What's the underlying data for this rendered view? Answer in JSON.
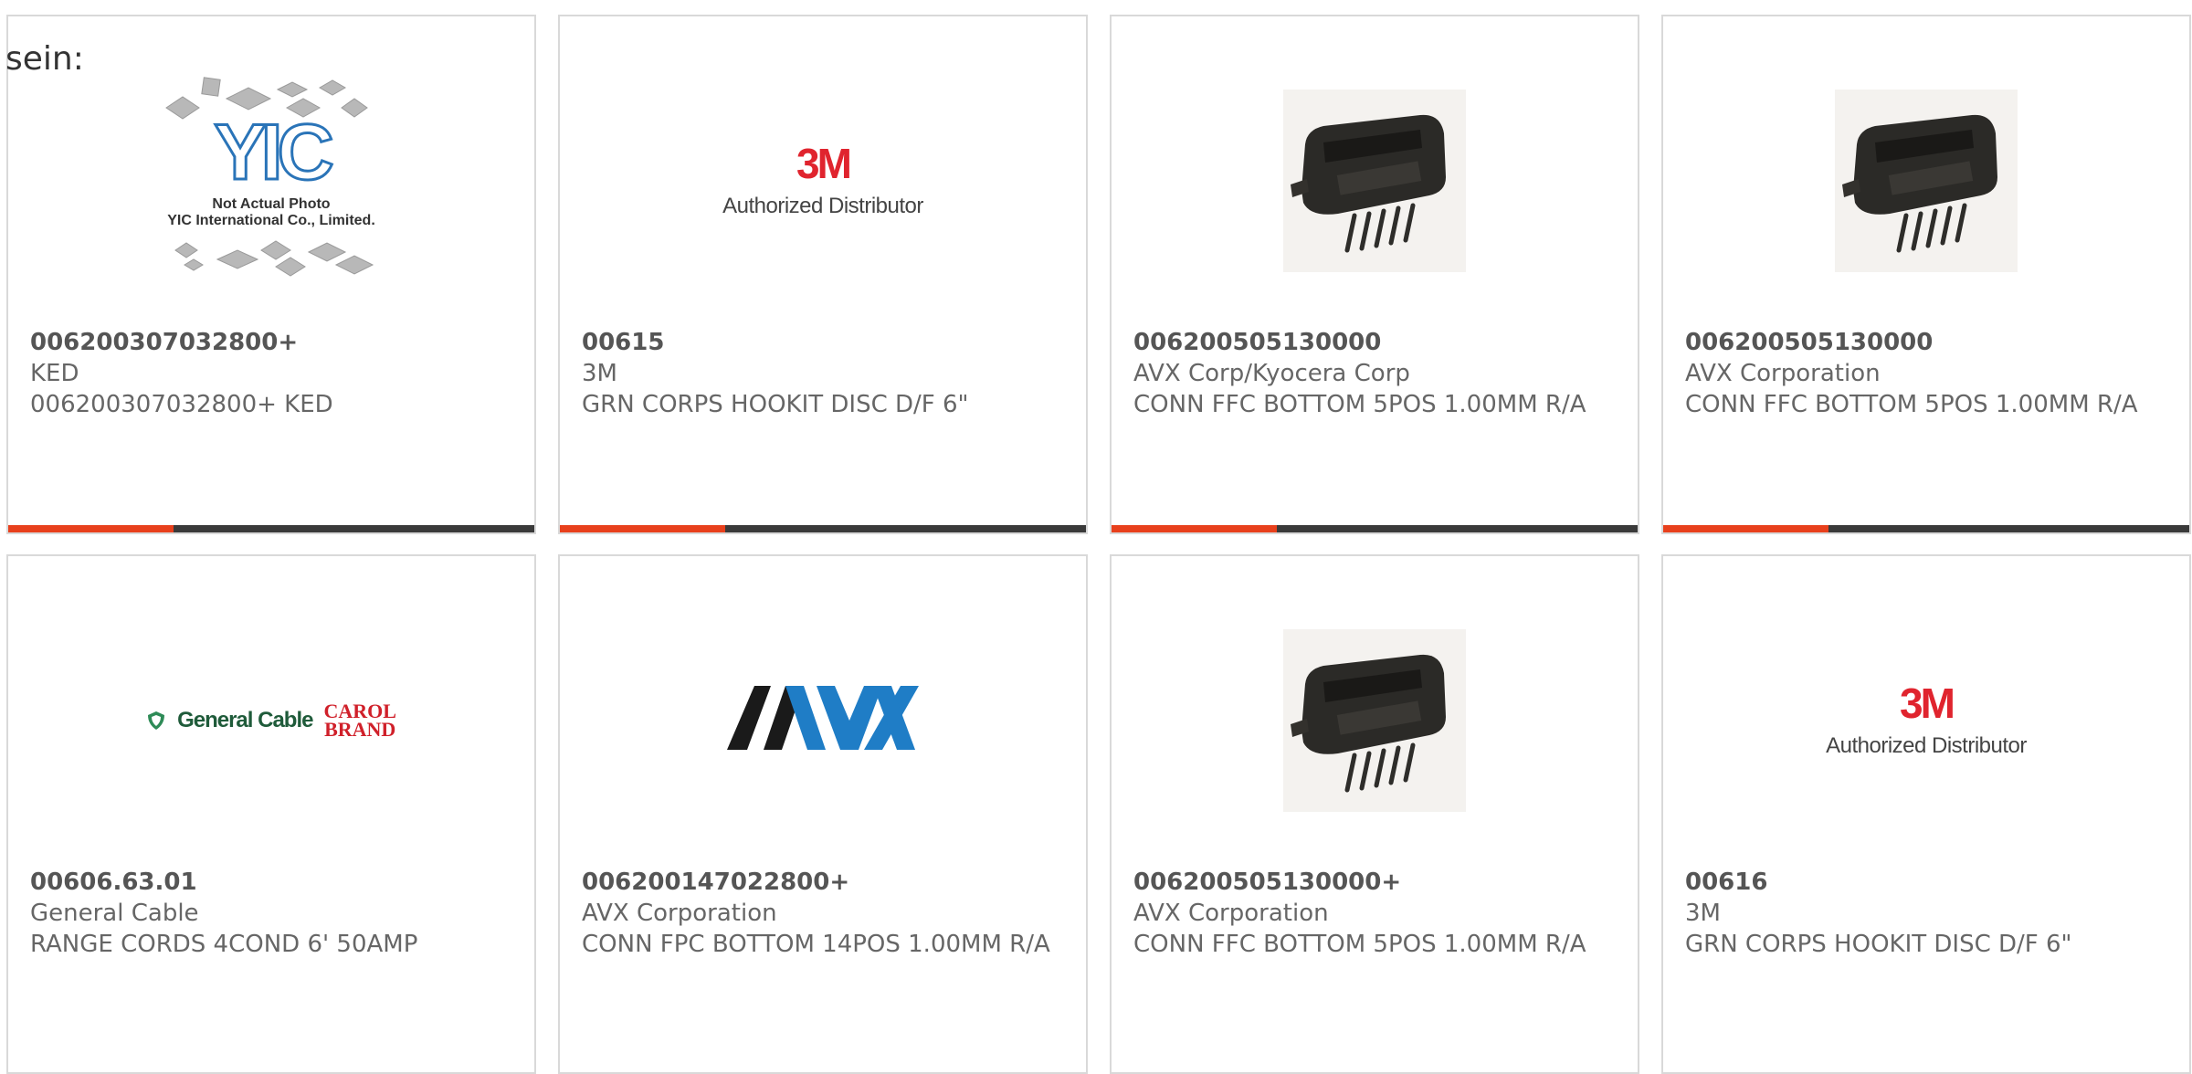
{
  "lead_text": "sein:",
  "products": [
    {
      "part_number": "006200307032800+",
      "manufacturer": "KED",
      "description": "006200307032800+ KED",
      "image": "yic-placeholder",
      "image_text": {
        "brand": "YIC",
        "line1": "Not Actual Photo",
        "line2": "YIC International Co., Limited."
      }
    },
    {
      "part_number": "00615",
      "manufacturer": "3M",
      "description": "GRN CORPS HOOKIT DISC D/F 6\"",
      "image": "3m-logo",
      "image_text": {
        "mark": "3M",
        "sub": "Authorized Distributor"
      }
    },
    {
      "part_number": "006200505130000",
      "manufacturer": "AVX Corp/Kyocera Corp",
      "description": "CONN FFC BOTTOM 5POS 1.00MM R/A",
      "image": "connector-photo"
    },
    {
      "part_number": "006200505130000",
      "manufacturer": "AVX Corporation",
      "description": "CONN FFC BOTTOM 5POS 1.00MM R/A",
      "image": "connector-photo"
    },
    {
      "part_number": "00606.63.01",
      "manufacturer": "General Cable",
      "description": "RANGE CORDS 4COND 6' 50AMP",
      "image": "general-cable-logo",
      "image_text": {
        "brand": "General Cable",
        "carol_top": "CAROL",
        "carol_bottom": "BRAND"
      }
    },
    {
      "part_number": "006200147022800+",
      "manufacturer": "AVX Corporation",
      "description": "CONN FPC BOTTOM 14POS 1.00MM R/A",
      "image": "avx-logo"
    },
    {
      "part_number": "006200505130000+",
      "manufacturer": "AVX Corporation",
      "description": "CONN FFC BOTTOM 5POS 1.00MM R/A",
      "image": "connector-photo"
    },
    {
      "part_number": "00616",
      "manufacturer": "3M",
      "description": "GRN CORPS HOOKIT DISC D/F 6\"",
      "image": "3m-logo",
      "image_text": {
        "mark": "3M",
        "sub": "Authorized Distributor"
      }
    }
  ],
  "colors": {
    "accent": "#e8401c",
    "bar_dark": "#3a3a3a",
    "card_border": "#d9d9d9"
  }
}
